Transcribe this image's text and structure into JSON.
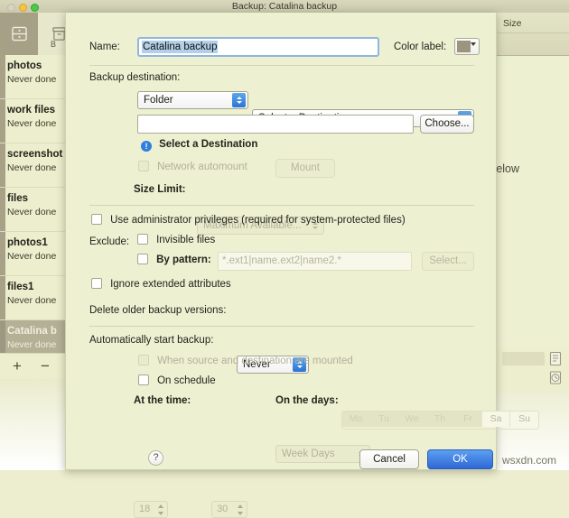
{
  "background": {
    "window_title": "Backup: Catalina backup",
    "toolbar": {
      "drawer_icon": "drawer-icon",
      "box_icon": "archive-box-icon",
      "sub_label": "B"
    },
    "column_header_size": "Size",
    "center_text": "on below",
    "watermark": "wsxdn.com",
    "right_icons": [
      "document-icon",
      "clock-icon"
    ],
    "sidebar": {
      "add_label": "+",
      "remove_label": "−",
      "items": [
        {
          "name": "photos",
          "status": "Never done",
          "selected": false
        },
        {
          "name": "work files",
          "status": "Never done",
          "selected": false
        },
        {
          "name": "screenshot",
          "status": "Never done",
          "selected": false
        },
        {
          "name": "files",
          "status": "Never done",
          "selected": false
        },
        {
          "name": "photos1",
          "status": "Never done",
          "selected": false
        },
        {
          "name": "files1",
          "status": "Never done",
          "selected": false
        },
        {
          "name": "Catalina b",
          "status": "Never done",
          "selected": true
        }
      ]
    }
  },
  "sheet": {
    "name_label": "Name:",
    "name_value": "Catalina backup",
    "color_label": "Color label:",
    "color_swatch": "#9b9580",
    "destination": {
      "section_label": "Backup destination:",
      "type_value": "Folder",
      "target_value": "Select a Destination",
      "path_value": "",
      "choose_label": "Choose...",
      "warning_icon": "info-icon",
      "warning_text": "Select a Destination",
      "automount_label": "Network automount",
      "mount_label": "Mount",
      "size_limit_label": "Size Limit:",
      "size_limit_value": "Maximum Available..."
    },
    "options": {
      "admin_label": "Use administrator privileges (required for system-protected files)",
      "exclude_label": "Exclude:",
      "invisible_label": "Invisible files",
      "by_pattern_label": "By pattern:",
      "pattern_placeholder": "*.ext1|name.ext2|name2.*",
      "select_label": "Select...",
      "ignore_xattr_label": "Ignore extended attributes",
      "delete_older_label": "Delete older backup versions:",
      "delete_older_value": "Never"
    },
    "schedule": {
      "section_label": "Automatically start backup:",
      "mounted_label": "When source and destination are mounted",
      "on_schedule_label": "On schedule",
      "frequency_value": "Week Days",
      "at_time_label": "At the time:",
      "hour_value": "18",
      "minute_value": "30",
      "on_days_label": "On the days:",
      "days": [
        {
          "label": "Mo",
          "selected": true
        },
        {
          "label": "Tu",
          "selected": true
        },
        {
          "label": "We",
          "selected": true
        },
        {
          "label": "Th",
          "selected": true
        },
        {
          "label": "Fr",
          "selected": true
        },
        {
          "label": "Sa",
          "selected": false
        },
        {
          "label": "Su",
          "selected": false
        }
      ]
    },
    "footer": {
      "help_label": "?",
      "cancel_label": "Cancel",
      "ok_label": "OK"
    }
  }
}
